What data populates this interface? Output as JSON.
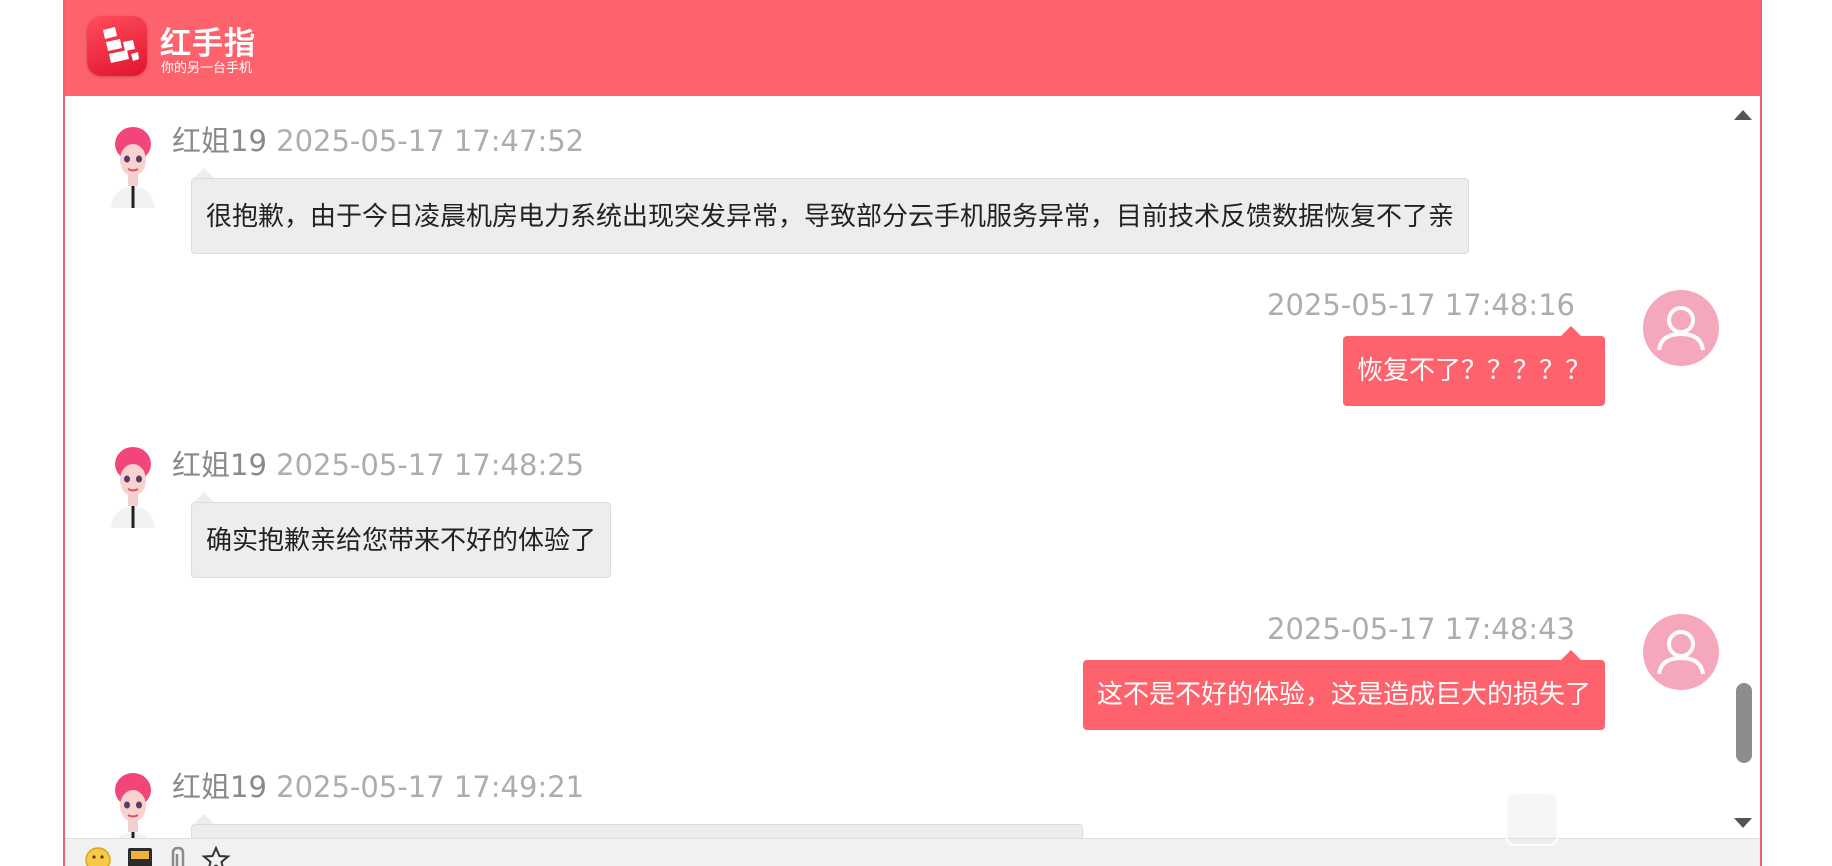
{
  "app": {
    "name": "红手指",
    "slogan": "你的另一台手机",
    "brand_color": "#fe636d"
  },
  "messages": [
    {
      "side": "agent",
      "sender": "红姐19",
      "time": "2025-05-17 17:47:52",
      "text": "很抱歉，由于今日凌晨机房电力系统出现突发异常，导致部分云手机服务异常，目前技术反馈数据恢复不了亲"
    },
    {
      "side": "user",
      "time": "2025-05-17 17:48:16",
      "text": "恢复不了？？？？？"
    },
    {
      "side": "agent",
      "sender": "红姐19",
      "time": "2025-05-17 17:48:25",
      "text": "确实抱歉亲给您带来不好的体验了"
    },
    {
      "side": "user",
      "time": "2025-05-17 17:48:43",
      "text": "这不是不好的体验，这是造成巨大的损失了"
    },
    {
      "side": "agent",
      "sender": "红姐19",
      "time": "2025-05-17 17:49:21",
      "text": ""
    }
  ],
  "toolbar": {
    "icons": [
      "emoji-icon",
      "image-icon",
      "attachment-icon",
      "star-icon"
    ]
  },
  "icons": {
    "agent_avatar": "agent-avatar-icon",
    "user_avatar": "user-avatar-icon",
    "scroll_up": "scroll-up-arrow-icon",
    "scroll_down": "scroll-down-arrow-icon"
  }
}
